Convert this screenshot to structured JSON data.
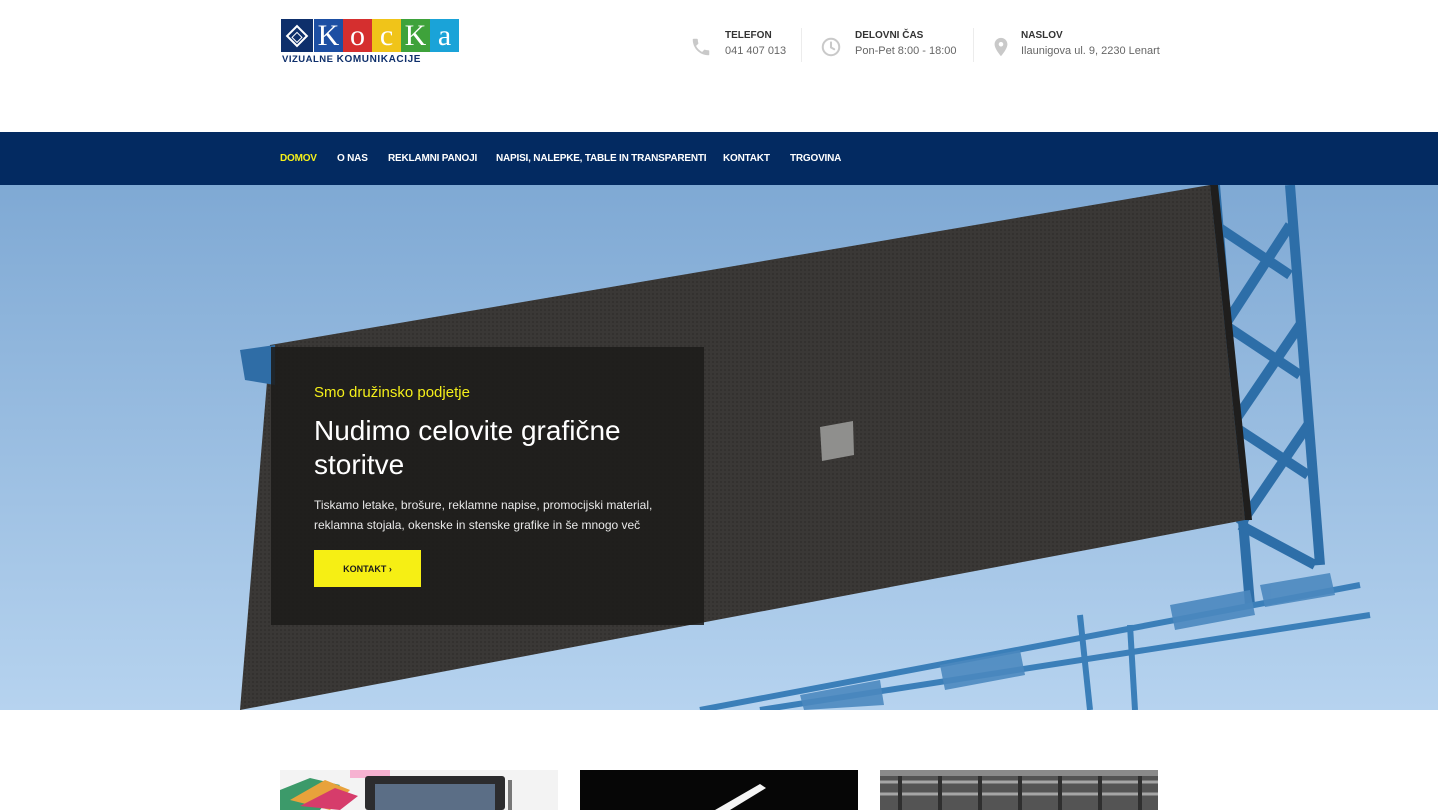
{
  "logo": {
    "letters": [
      "K",
      "o",
      "c",
      "K",
      "a"
    ],
    "letter_colors": [
      "#1d4fa3",
      "#d52f2f",
      "#f0c419",
      "#3ea23b",
      "#1aa3d8"
    ],
    "subtitle_small": "VIZUALNE",
    "subtitle_big": "KOMUNIKACIJE"
  },
  "contact_info": [
    {
      "icon": "phone-icon",
      "title": "TELEFON",
      "value": "041 407 013"
    },
    {
      "icon": "clock-icon",
      "title": "DELOVNI ČAS",
      "value": "Pon-Pet 8:00 - 18:00"
    },
    {
      "icon": "map-pin-icon",
      "title": "NASLOV",
      "value": "Ilaunigova ul. 9, 2230 Lenart"
    }
  ],
  "nav": {
    "items": [
      "DOMOV",
      "O NAS",
      "REKLAMNI PANOJI",
      "NAPISI, NALEPKE, TABLE IN TRANSPARENTI",
      "KONTAKT",
      "TRGOVINA"
    ],
    "active": "DOMOV"
  },
  "hero": {
    "eyebrow": "Smo družinsko podjetje",
    "title": "Nudimo celovite grafične storitve",
    "text": "Tiskamo letake, brošure, reklamne napise, promocijski material, reklamna stojala, okenske in stenske grafike in še mnogo več",
    "button_label": "KONTAKT ›"
  },
  "colors": {
    "nav_bg": "#032a61",
    "accent_yellow": "#f4ef1a",
    "card_bg": "#1c1b1a"
  }
}
